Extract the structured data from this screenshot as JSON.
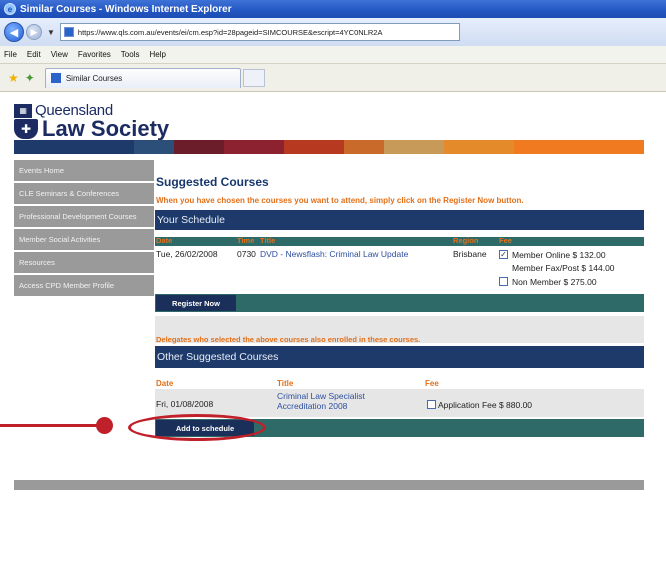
{
  "window": {
    "title": "Similar Courses - Windows Internet Explorer",
    "url": "https://www.qls.com.au/events/ei/cm.esp?id=28pageid=SIMCOURSE&escript=4YC0NLR2A",
    "tab_title": "Similar Courses"
  },
  "menu": [
    "File",
    "Edit",
    "View",
    "Favorites",
    "Tools",
    "Help"
  ],
  "logo": {
    "line1": "Queensland",
    "line2": "Law Society"
  },
  "sidebar": [
    "Events Home",
    "CLE Seminars & Conferences",
    "Professional Development Courses",
    "Member Social Activities",
    "Resources",
    "Access CPD Member Profile"
  ],
  "main": {
    "title": "Suggested Courses",
    "instruction": "When you have chosen the courses you want to attend, simply click on the Register Now button.",
    "schedule_heading": "Your Schedule",
    "schedule_columns": {
      "date": "Date",
      "time": "Time",
      "title": "Title",
      "region": "Region",
      "fee": "Fee"
    },
    "schedule_row": {
      "date": "Tue, 26/02/2008",
      "time": "0730",
      "title": "DVD - Newsflash: Criminal Law Update",
      "region": "Brisbane",
      "fee_member_online": "Member Online $ 132.00",
      "fee_member_fax": "Member Fax/Post $ 144.00",
      "fee_non_member": "Non Member $ 275.00"
    },
    "register_button": "Register Now",
    "delegates_note": "Delegates who selected the above courses also enrolled in these courses.",
    "other_heading": "Other Suggested Courses",
    "other_columns": {
      "date": "Date",
      "title": "Title",
      "fee": "Fee"
    },
    "other_row": {
      "date": "Fri, 01/08/2008",
      "title_line1": "Criminal Law Specialist",
      "title_line2": "Accreditation 2008",
      "fee": "Application Fee $ 880.00"
    },
    "add_button": "Add to schedule"
  },
  "colors": {
    "navy": "#1d3a6b",
    "teal": "#2e6b68",
    "orange": "#e2701a",
    "annotation_red": "#c0202a"
  }
}
